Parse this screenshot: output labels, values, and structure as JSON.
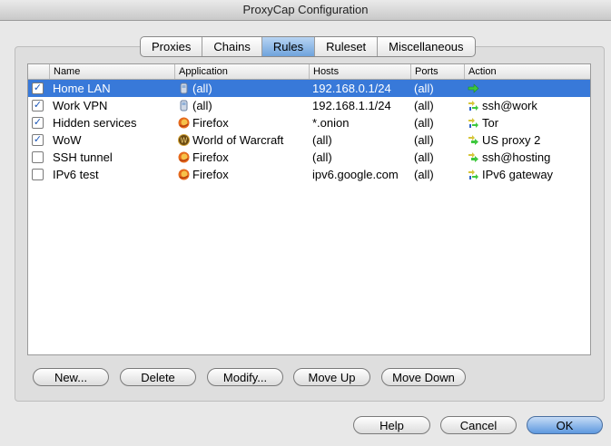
{
  "window": {
    "title": "ProxyCap Configuration"
  },
  "tabs": [
    {
      "label": "Proxies"
    },
    {
      "label": "Chains"
    },
    {
      "label": "Rules",
      "active": true
    },
    {
      "label": "Ruleset"
    },
    {
      "label": "Miscellaneous"
    }
  ],
  "table": {
    "columns": [
      "Name",
      "Application",
      "Hosts",
      "Ports",
      "Action"
    ],
    "rows": [
      {
        "checked": true,
        "name": "Home LAN",
        "app_icon": "generic-app-icon",
        "app": "(all)",
        "hosts": "192.168.0.1/24",
        "ports": "(all)",
        "action_icon": "direct-arrow-icon",
        "action": "",
        "selected": true
      },
      {
        "checked": true,
        "name": "Work VPN",
        "app_icon": "generic-app-icon",
        "app": "(all)",
        "hosts": "192.168.1.1/24",
        "ports": "(all)",
        "action_icon": "chain-icon",
        "action": "ssh@work"
      },
      {
        "checked": true,
        "name": "Hidden services",
        "app_icon": "firefox-icon",
        "app": "Firefox",
        "hosts": "*.onion",
        "ports": "(all)",
        "action_icon": "chain-icon",
        "action": "Tor"
      },
      {
        "checked": true,
        "name": "WoW",
        "app_icon": "world-of-warcraft-icon",
        "app": "World of Warcraft",
        "hosts": "(all)",
        "ports": "(all)",
        "action_icon": "proxy-icon",
        "action": "US proxy 2"
      },
      {
        "checked": false,
        "name": "SSH tunnel",
        "app_icon": "firefox-icon",
        "app": "Firefox",
        "hosts": "(all)",
        "ports": "(all)",
        "action_icon": "proxy-icon",
        "action": "ssh@hosting"
      },
      {
        "checked": false,
        "name": "IPv6 test",
        "app_icon": "firefox-icon",
        "app": "Firefox",
        "hosts": "ipv6.google.com",
        "ports": "(all)",
        "action_icon": "chain-icon",
        "action": "IPv6 gateway"
      }
    ]
  },
  "rule_buttons": {
    "new": "New...",
    "delete": "Delete",
    "modify": "Modify...",
    "move_up": "Move Up",
    "move_down": "Move Down"
  },
  "dialog_buttons": {
    "help": "Help",
    "cancel": "Cancel",
    "ok": "OK"
  },
  "colors": {
    "selection": "#3879d9",
    "default_button": "#5d98df"
  }
}
